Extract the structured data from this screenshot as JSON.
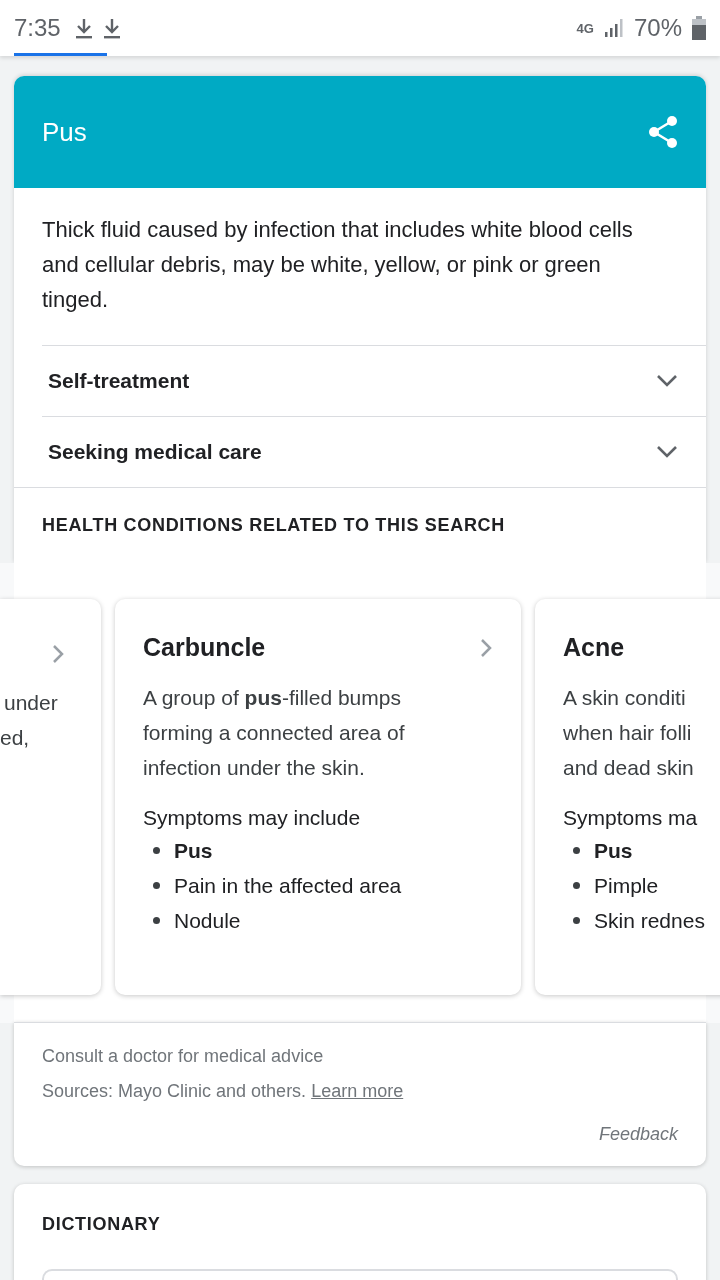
{
  "status_bar": {
    "time": "7:35",
    "network": "4G",
    "battery": "70%",
    "notifications": [
      {
        "kind": "download"
      },
      {
        "kind": "download"
      }
    ]
  },
  "card": {
    "title": "Pus",
    "description": "Thick fluid caused by infection that includes white blood cells and cellular debris, may be white, yellow, or pink or green tinged.",
    "sections": [
      {
        "label": "Self-treatment",
        "expanded": false
      },
      {
        "label": "Seeking medical care",
        "expanded": false
      }
    ],
    "related_heading": "HEALTH CONDITIONS RELATED TO THIS SEARCH",
    "conditions": [
      {
        "kind": "clipped_left",
        "lines": [
          "under",
          "ed,"
        ]
      },
      {
        "kind": "full",
        "title": "Carbuncle",
        "description": "A group of **pus**-filled bumps forming a connected area of infection under the skin.",
        "symptoms_label": "Symptoms may include",
        "symptoms": [
          {
            "text": "Pus",
            "bold": true
          },
          {
            "text": "Pain in the affected area",
            "bold": false
          },
          {
            "text": "Nodule",
            "bold": false
          }
        ]
      },
      {
        "kind": "clipped_right",
        "title": "Acne",
        "lines": [
          "A skin conditi",
          "when hair folli",
          "and dead skin"
        ],
        "symptoms_label": "Symptoms ma",
        "symptoms": [
          {
            "text": "Pus",
            "bold": true
          },
          {
            "text": "Pimple",
            "bold": false
          },
          {
            "text": "Skin rednes",
            "bold": false
          }
        ]
      }
    ],
    "disclaimer": "Consult a doctor for medical advice",
    "sources": "Sources: Mayo Clinic and others.",
    "learn_more": "Learn more",
    "feedback": "Feedback"
  },
  "dictionary": {
    "heading": "DICTIONARY"
  }
}
